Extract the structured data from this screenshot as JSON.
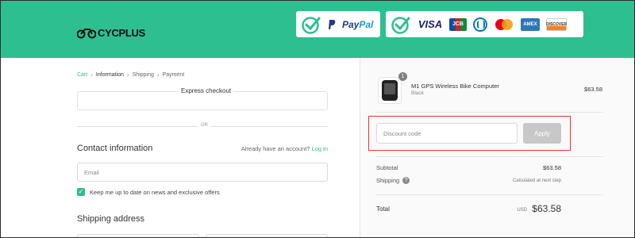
{
  "header": {
    "logo_text": "CYCPLUS",
    "payment_badges": {
      "paypal": {
        "brand_word_1": "Pay",
        "brand_word_2": "Pal"
      },
      "cards": [
        "VISA",
        "JCB",
        "Diners Club",
        "Mastercard",
        "AMEX",
        "DISCOVER"
      ]
    },
    "colors": {
      "brand_green": "#2ebf91"
    }
  },
  "breadcrumb": {
    "items": [
      "Cart",
      "Information",
      "Shipping",
      "Payment"
    ],
    "current": "Information"
  },
  "express": {
    "label": "Express checkout",
    "separator": "OR"
  },
  "contact": {
    "title": "Contact information",
    "have_account": "Already have an account?",
    "login_link": "Log in",
    "email_placeholder": "Email",
    "newsletter_label": "Keep me up to date on news and exclusive offers",
    "newsletter_checked": true
  },
  "shipping": {
    "title": "Shipping address"
  },
  "order": {
    "product": {
      "name": "M1 GPS Wireless Bike Computer",
      "variant": "Black",
      "price": "$63.58",
      "quantity": "1"
    },
    "discount": {
      "placeholder": "Discount code",
      "apply_label": "Apply"
    },
    "subtotal_label": "Subtotal",
    "subtotal_value": "$63.58",
    "shipping_label": "Shipping",
    "shipping_value": "Calculated at next step",
    "total_label": "Total",
    "total_currency": "USD",
    "total_value": "$63.58"
  }
}
